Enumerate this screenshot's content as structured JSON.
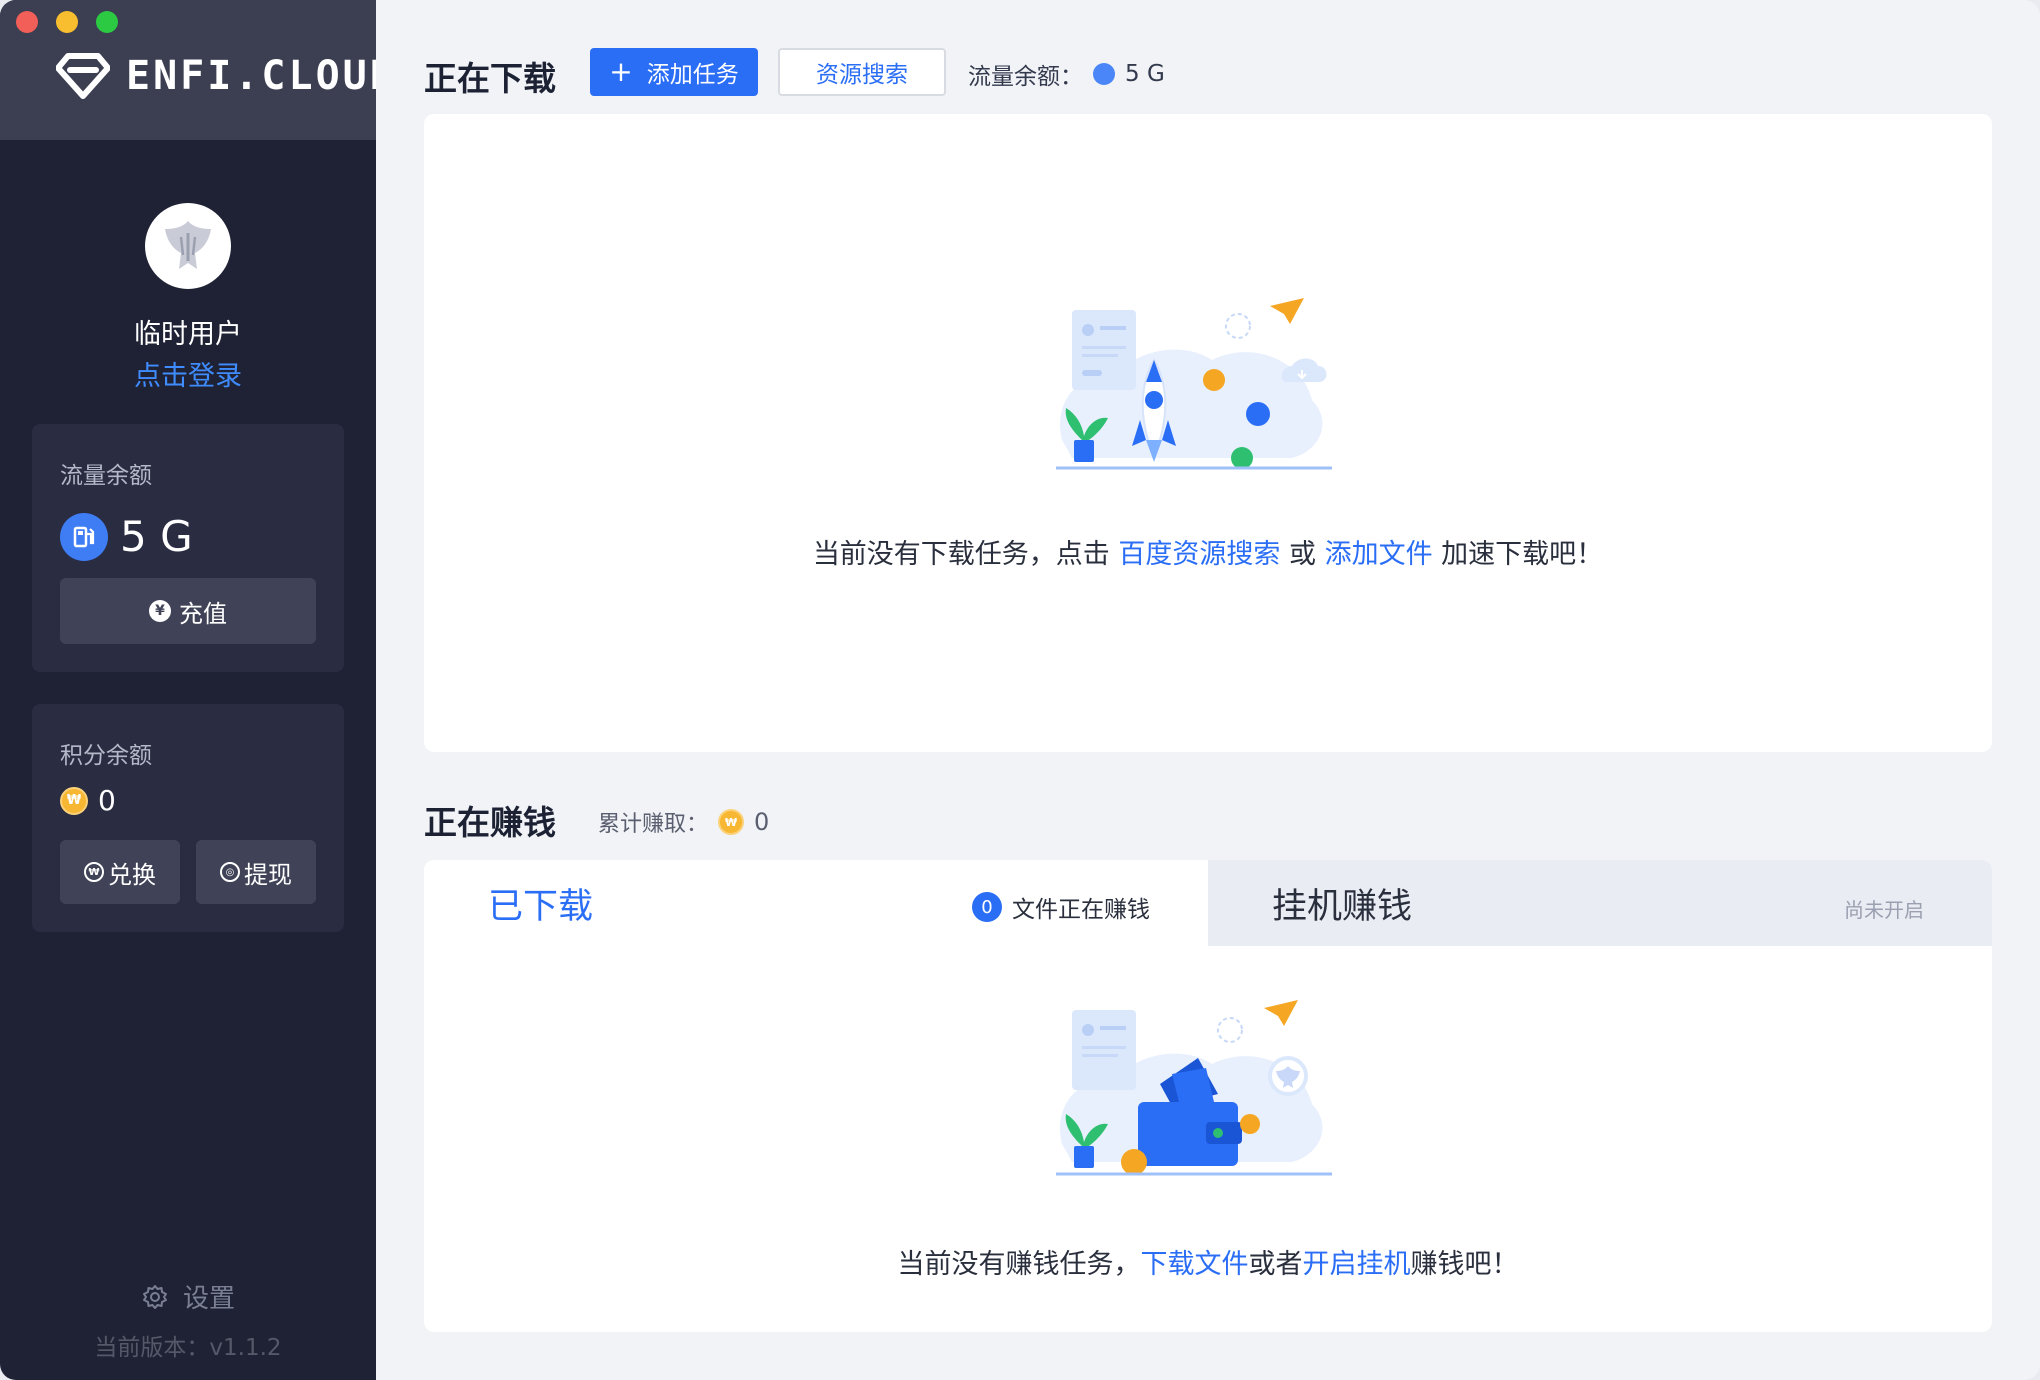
{
  "sidebar": {
    "logo_text": "ENFI.CLOUD",
    "user_name": "临时用户",
    "login_label": "点击登录",
    "flow_card": {
      "label": "流量余额",
      "value": "5 G",
      "recharge_label": "充值",
      "recharge_icon": "¥"
    },
    "points_card": {
      "label": "积分余额",
      "value": "0",
      "exchange_label": "兑换",
      "withdraw_label": "提现"
    },
    "settings_label": "设置",
    "version_label": "当前版本：v1.1.2"
  },
  "downloading": {
    "title": "正在下载",
    "add_task_label": "添加任务",
    "search_label": "资源搜索",
    "flow_label": "流量余额：",
    "flow_value": "5 G",
    "empty_prefix": "当前没有下载任务，点击 ",
    "empty_link1": "百度资源搜索",
    "empty_middle": " 或 ",
    "empty_link2": "添加文件",
    "empty_suffix": " 加速下载吧！"
  },
  "earning": {
    "title": "正在赚钱",
    "earned_label": "累计赚取：",
    "earned_value": "0",
    "tab_downloaded": "已下载",
    "files_count": "0",
    "files_label": "文件正在赚钱",
    "tab_idle": "挂机赚钱",
    "idle_status": "尚未开启",
    "empty_prefix": "当前没有赚钱任务，",
    "empty_link1": "下载文件",
    "empty_middle": "或者",
    "empty_link2": "开启挂机",
    "empty_suffix": "赚钱吧！"
  },
  "colors": {
    "accent": "#2b6ef6",
    "sidebar_bg": "#1f2235",
    "coin": "#f7b733"
  },
  "icons": [
    "diamond-logo-icon",
    "eagle-avatar-icon",
    "fuel-icon",
    "yen-icon",
    "coin-icon",
    "gear-icon",
    "plus-icon",
    "rocket-illustration",
    "wallet-illustration"
  ]
}
